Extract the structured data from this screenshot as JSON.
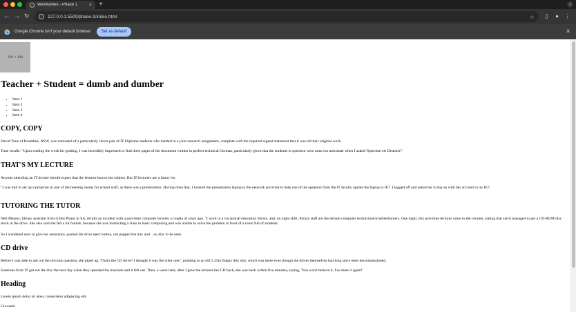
{
  "browser": {
    "tab_title": "Wireframes - Phase 1",
    "tab_close": "×",
    "new_tab": "+",
    "url": "127.0.0.1:5500/phase-1/index.html"
  },
  "infobar": {
    "message": "Google Chrome isn't your default browser",
    "button_label": "Set as default"
  },
  "page": {
    "image_placeholder": "100 × 100",
    "title": "Teacher + Student = dumb and dumber",
    "list_items": [
      "Item 1",
      "Item 2",
      "Item 3",
      "Item 4"
    ],
    "sections": {
      "copy": {
        "heading": "COPY, COPY",
        "p1": "David Tune of Boambee, NSW, was reminded of a particularly clever pair of IT Diploma students who handed in a joint research assignment, complete with the required signed statement that it was all their original work.",
        "p2": "Tune recalls: \"Upon reading the work for grading, I was incredibly impressed to find three pages of the document written in perfect technical German, particularly given that the students in question were none too articulate when I asked 'Sprechen sie Deutsch?'"
      },
      "lecture": {
        "heading": "THAT'S MY LECTURE",
        "p1": "Anyone attending an IT lecture should expect that the lecturer knows the subject. But IT lecturers are a funny lot.",
        "p2": "\"I was told to set up a projector in one of the meeting rooms for school staff, as there was a presentation. Having done that, I hooked the presentation laptop to the network and tried to help one of the speakers from the IT faculty update the laptop to IE7. I logged off and asked her to log on with her account to try IE7."
      },
      "tutor": {
        "heading": "TUTORING THE TUTOR",
        "p1": "Neil Meyers, library assistant from Gilles Plains in SA, recalls an incident with a part-time computer lecturer a couple of years ago. \"I work in a vocational education library, and, on night shift, library staff are the default computer technicians/troubleshooters. One night, this part-time lecturer came to the counter, stating that she'd managed to get a CD-ROM disc stuck in the drive. She also said she felt a bit foolish, because she was instructing a class in basic computing and was unable to solve the problem in front of a room full of students.",
        "p2": "So I wandered over to give her assistance, pushed the drive eject button, out popped the tray and... no disc to be seen."
      },
      "cd": {
        "heading": "CD drive",
        "p1": "Before I was able to ask out the obvious question, she piped up, 'That's the CD drive? I thought it was the other one!', pointing to an old 5.25in floppy disc slot, which was there even though the drives themselves had long since been decommissioned.",
        "p2": "Someone from IT got out the disc the next day when they upended the machine and it fell out. Then, a week later, after I gave the lecturer her CD back, she was back within five minutes, saying, 'You won't believe it, I've done it again!'"
      },
      "last": {
        "heading": "Heading",
        "p1": "Lorem ipsum dolor sit amet, consectetur adipiscing elit.",
        "p2": "Giovanni"
      }
    }
  }
}
